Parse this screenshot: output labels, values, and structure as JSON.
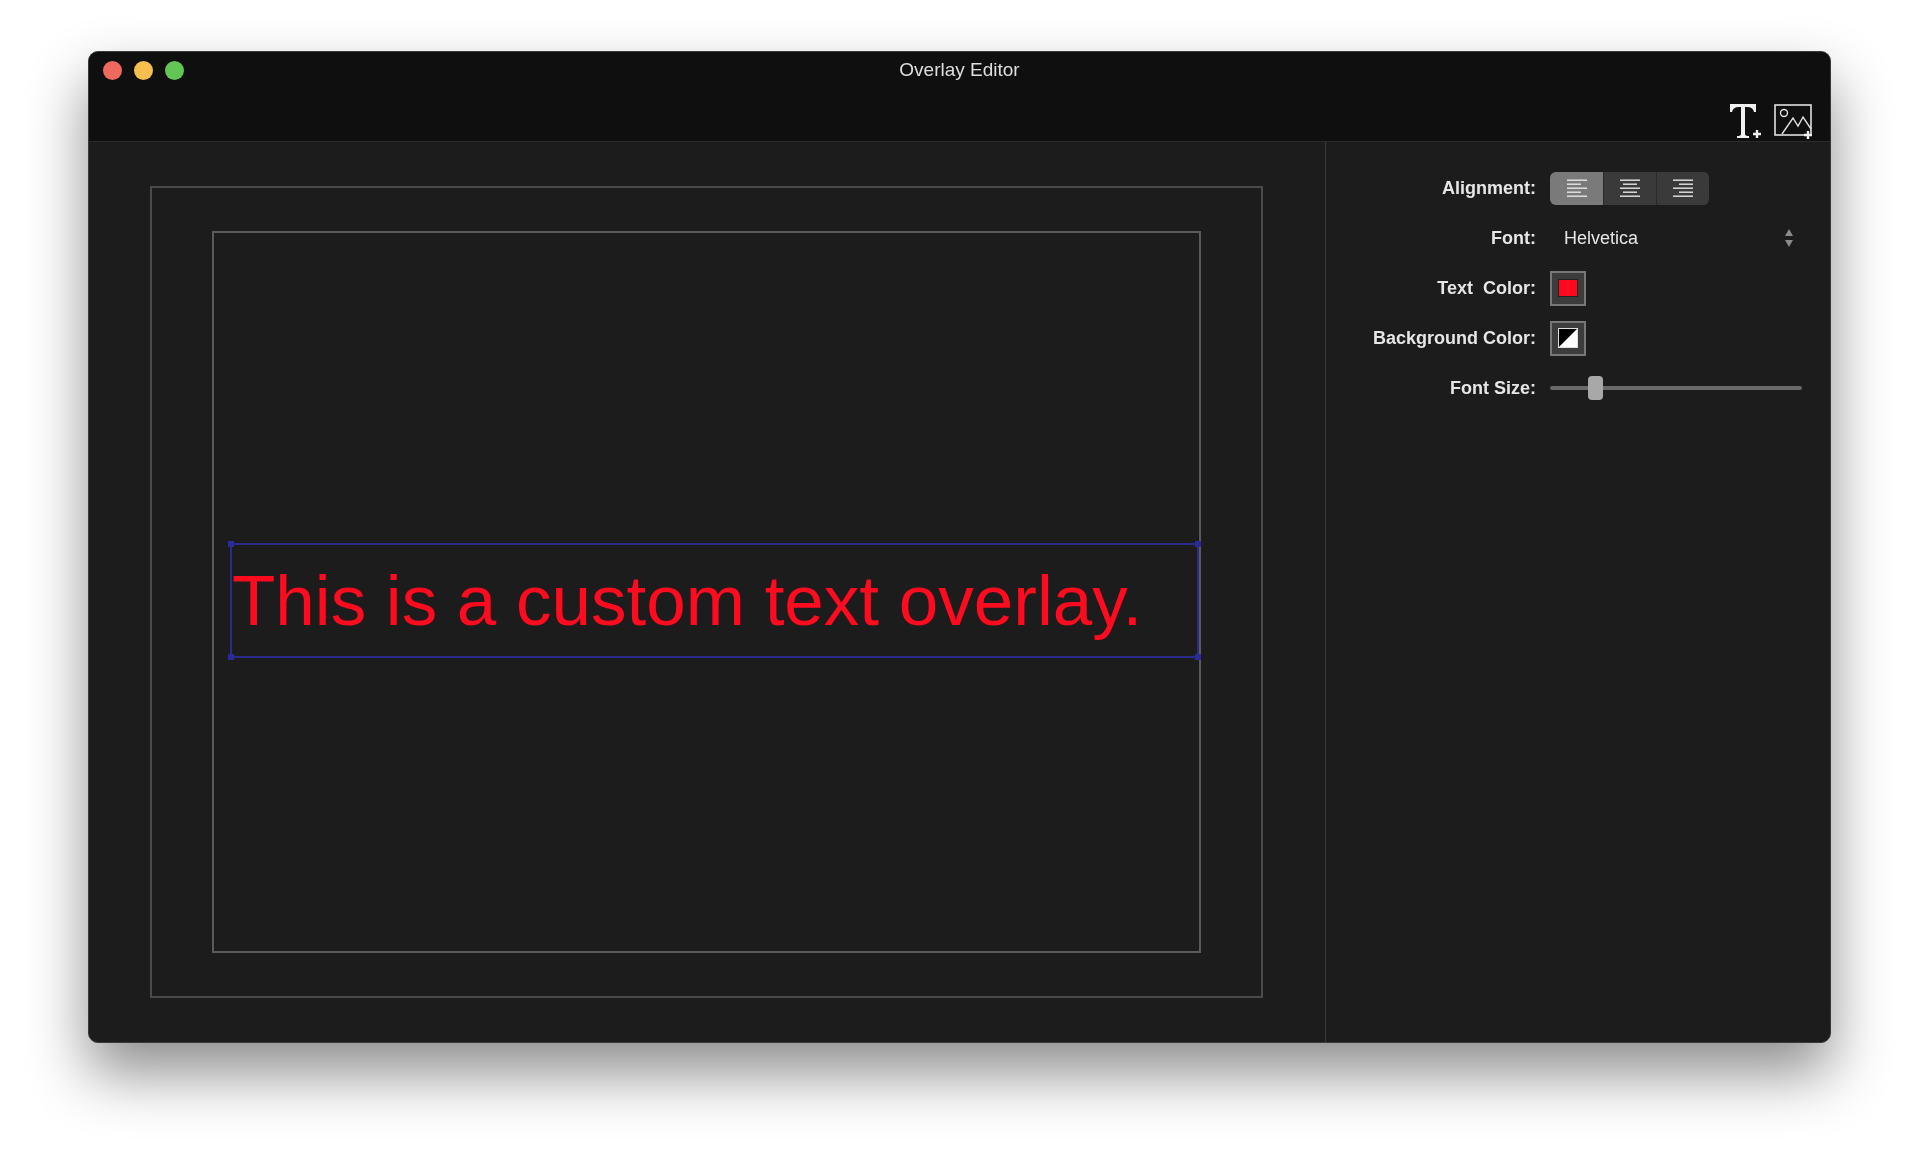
{
  "window": {
    "title": "Overlay Editor"
  },
  "canvas": {
    "overlay_text": "This is a custom text overlay.",
    "selected": true
  },
  "inspector": {
    "alignment": {
      "label": "Alignment:",
      "options": [
        {
          "kind": "left",
          "selected": true
        },
        {
          "kind": "center",
          "selected": false
        },
        {
          "kind": "right",
          "selected": false
        }
      ]
    },
    "font": {
      "label": "Font:",
      "value": "Helvetica"
    },
    "text_color": {
      "label": "Text  Color:",
      "color": "#ff0a1e"
    },
    "background_color": {
      "label": "Background Color:"
    },
    "font_size": {
      "label": "Font Size:",
      "level": 0.18
    }
  }
}
